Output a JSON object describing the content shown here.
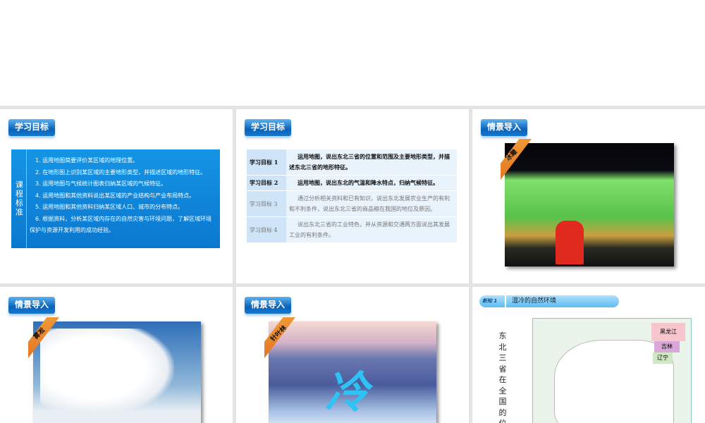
{
  "slides": [
    {
      "badge": "学习目标",
      "side_label": "课程标准",
      "items": [
        "1. 运用地图简要评价某区域的地理位置。",
        "2. 在地形图上识别某区域的主要地形类型，并描述区域的地形特征。",
        "3. 运用地图与气候统计图表归纳某区域的气候特征。",
        "4. 运用地图和其他资料说出某区域的产业结构与产业布局特点。",
        "5. 运用地图和其他资料归纳某区域人口、城市的分布特点。",
        "6. 根据资料，分析某区域内存在的自然灾害与环境问题，了解区域环境保护与资源开发利用的成功经验。"
      ]
    },
    {
      "badge": "学习目标",
      "rows": [
        {
          "key": "学习目标 1",
          "text": "运用地图，说出东北三省的位置和范围及主要地形类型，并描述东北三省的地形特征。"
        },
        {
          "key": "学习目标 2",
          "text": "运用地图，说出东北的气温和降水特点，归纳气候特征。"
        },
        {
          "key": "学习目标 3",
          "text": "通过分析相关资料和已有知识，说出东北发展农业生产的有利和不利条件，说出东北三省的商品粮在我国的地位及原因。"
        },
        {
          "key": "学习目标 4",
          "text": "说出东北三省的工业特色，并从资源和交通两方面说出其发展工业的有利条件。"
        }
      ]
    },
    {
      "badge": "情景导入",
      "ribbon": "冰雕"
    },
    {
      "badge": "情景导入",
      "ribbon": "雾凇"
    },
    {
      "badge": "情景导入",
      "ribbon": "针叶林"
    },
    {
      "tag": "新知 1",
      "title": "湿冷的自然环境",
      "vertical": "东北三省在全国的位置",
      "map_labels": [
        "黑龙江",
        "吉林",
        "辽宁"
      ]
    }
  ]
}
